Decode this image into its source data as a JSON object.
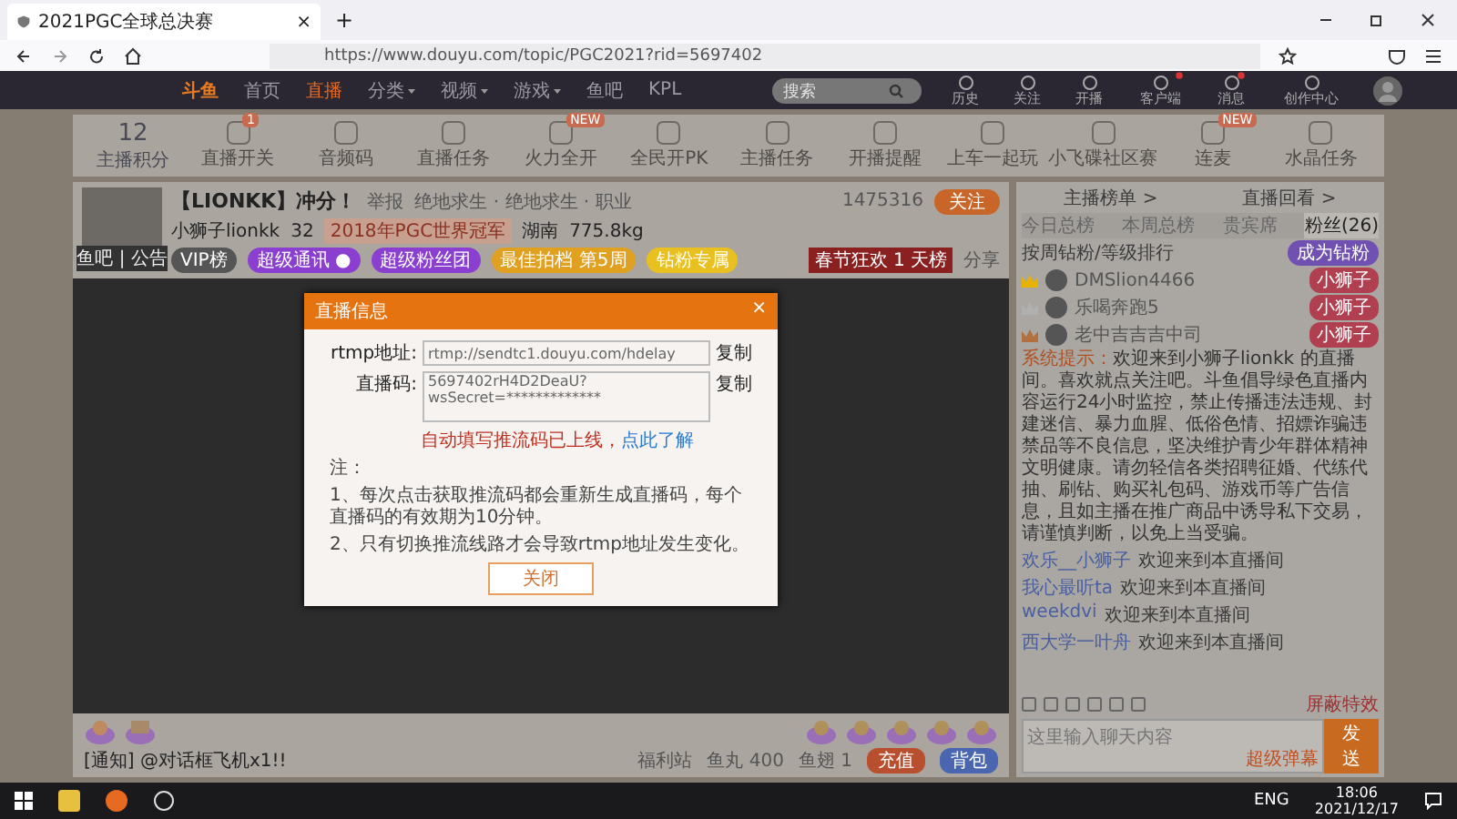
{
  "browser_tab": {
    "title": "2021PGC全球总决赛",
    "close": "×"
  },
  "new_tab": "+",
  "address_bar": {
    "url": "https://www.douyu.com/topic/PGC2021?rid=5697402"
  },
  "site_nav": {
    "logo": "斗鱼",
    "items": [
      {
        "label": "首页",
        "selected": false,
        "dropdown": false
      },
      {
        "label": "直播",
        "selected": true,
        "dropdown": false
      },
      {
        "label": "分类",
        "selected": false,
        "dropdown": true
      },
      {
        "label": "视频",
        "selected": false,
        "dropdown": true
      },
      {
        "label": "游戏",
        "selected": false,
        "dropdown": true
      },
      {
        "label": "鱼吧",
        "selected": false,
        "dropdown": false
      },
      {
        "label": "KPL",
        "selected": false,
        "dropdown": false
      }
    ],
    "search": {
      "placeholder": "搜索"
    },
    "actions": [
      {
        "label": "历史",
        "badge": false
      },
      {
        "label": "关注",
        "badge": false
      },
      {
        "label": "开播",
        "badge": false
      },
      {
        "label": "客户端",
        "badge": true
      },
      {
        "label": "消息",
        "badge": true
      },
      {
        "label": "创作中心",
        "badge": false
      }
    ]
  },
  "anchor_toolbar": {
    "score": "12",
    "score_label": "主播积分",
    "items": [
      {
        "label": "直播开关",
        "tag": "1"
      },
      {
        "label": "音频码"
      },
      {
        "label": "直播任务"
      },
      {
        "label": "火力全开",
        "tag": "NEW"
      },
      {
        "label": "全民开PK"
      },
      {
        "label": "主播任务"
      },
      {
        "label": "开播提醒"
      },
      {
        "label": "上车一起玩"
      },
      {
        "label": "小飞碟社区赛"
      },
      {
        "label": "连麦",
        "tag": "NEW"
      },
      {
        "label": "水晶任务"
      }
    ]
  },
  "room": {
    "title": "【LIONKK】冲分！",
    "report": "举报",
    "category": "绝地求生 · 绝地求生 · 职业",
    "avatar_caption": "鱼吧 | 公告",
    "host_name": "小狮子lionkk",
    "heat": "32",
    "honor": "2018年PGC世界冠军",
    "location": "湖南",
    "weight": "775.8kg",
    "room_id": "1475316",
    "follow": "关注",
    "badges": [
      {
        "label": "VIP榜",
        "color": "#555555"
      },
      {
        "label": "超级通讯 ●",
        "color": "#8a3fd1"
      },
      {
        "label": "超级粉丝团",
        "color": "#8a3fd1"
      },
      {
        "label": "最佳拍档 第5周",
        "color": "#e0a020"
      },
      {
        "label": "钻粉专属",
        "color": "#e8c020"
      }
    ],
    "rank_banner": "春节狂欢 1 天榜",
    "share": "分享"
  },
  "modal": {
    "title": "直播信息",
    "close": "×",
    "rtmp_label": "rtmp地址:",
    "rtmp_value": "rtmp://sendtc1.douyu.com/hdelay",
    "copy_1": "复制",
    "code_label": "直播码:",
    "code_value": "5697402rH4D2DeaU?wsSecret=*************",
    "copy_2": "复制",
    "warning": "自动填写推流码已上线，",
    "learn_more": "点此了解",
    "notes": [
      "注：",
      "1、每次点击获取推流码都会重新生成直播码，每个直播码的有效期为10分钟。",
      "2、只有切换推流线路才会导致rtmp地址发生变化。"
    ],
    "close_button": "关闭"
  },
  "gift_bar": {
    "notice": "[通知] @对话框飞机x1!!",
    "welfare": "福利站",
    "fish_ball": "鱼丸 400",
    "fin": "鱼翅 1",
    "recharge": "充值",
    "backpack": "背包"
  },
  "chat": {
    "links": [
      "主播榜单 >",
      "直播回看 >"
    ],
    "tabs": [
      {
        "label": "今日总榜",
        "selected": false
      },
      {
        "label": "本周总榜",
        "selected": false
      },
      {
        "label": "贵宾席",
        "selected": false
      },
      {
        "label": "粉丝(26)",
        "selected": true
      }
    ],
    "ranking_title": "按周钻粉/等级排行",
    "become_fan": "成为钻粉",
    "ranking": [
      {
        "name": "DMSlion4466",
        "color": "#e6b400",
        "fan_badge": "小狮子"
      },
      {
        "name": "乐喝奔跑5",
        "color": "#b0b0b0",
        "fan_badge": "小狮子"
      },
      {
        "name": "老中吉吉吉中司",
        "color": "#b07040",
        "fan_badge": "小狮子"
      }
    ],
    "system_label": "系统提示：",
    "system_text": "欢迎来到小狮子lionkk 的直播间。喜欢就点关注吧。斗鱼倡导绿色直播内容运行24小时监控，禁止传播违法违规、封建迷信、暴力血腥、低俗色情、招嫖诈骗违禁品等不良信息，坚决维护青少年群体精神文明健康。请勿轻信各类招聘征婚、代练代抽、刷钻、购买礼包码、游戏币等广告信息，且如主播在推广商品中诱导私下交易，请谨慎判断，以免上当受骗。",
    "messages": [
      {
        "user": "欢乐__小狮子",
        "text": "欢迎来到本直播间"
      },
      {
        "user": "我心最听ta",
        "text": "欢迎来到本直播间"
      },
      {
        "user": "weekdvi",
        "text": "欢迎来到本直播间"
      },
      {
        "user": "西大学一叶舟",
        "text": "欢迎来到本直播间"
      }
    ],
    "shield": "屏蔽特效",
    "input_placeholder": "这里输入聊天内容",
    "super_danmaku": "超级弹幕",
    "send": "发送"
  },
  "taskbar": {
    "language": "ENG",
    "time": "18:06",
    "date": "2021/12/17"
  }
}
